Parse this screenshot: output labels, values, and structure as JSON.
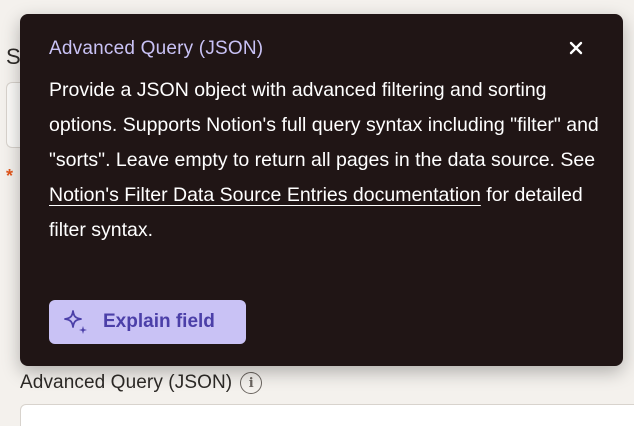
{
  "background_form": {
    "partial_heading_letter": "S",
    "required_marker": "*",
    "field_label": "Advanced Query (JSON)"
  },
  "tooltip": {
    "title": "Advanced Query (JSON)",
    "close_icon": "close-icon",
    "body_part1": "Provide a JSON object with advanced filtering and sorting options. Supports Notion's full query syntax including \"filter\" and \"sorts\". Leave empty to return all pages in the data source. See ",
    "link_text": "Notion's Filter Data Source Entries documentation",
    "body_part2": " for detailed filter syntax.",
    "explain_button": {
      "label": "Explain field",
      "icon": "sparkle-icon"
    }
  },
  "colors": {
    "tooltip_bg": "#201515",
    "title": "#c9c2f5",
    "button_bg": "#c9c2f5",
    "button_text": "#4b3fa8",
    "required": "#e2561b"
  }
}
